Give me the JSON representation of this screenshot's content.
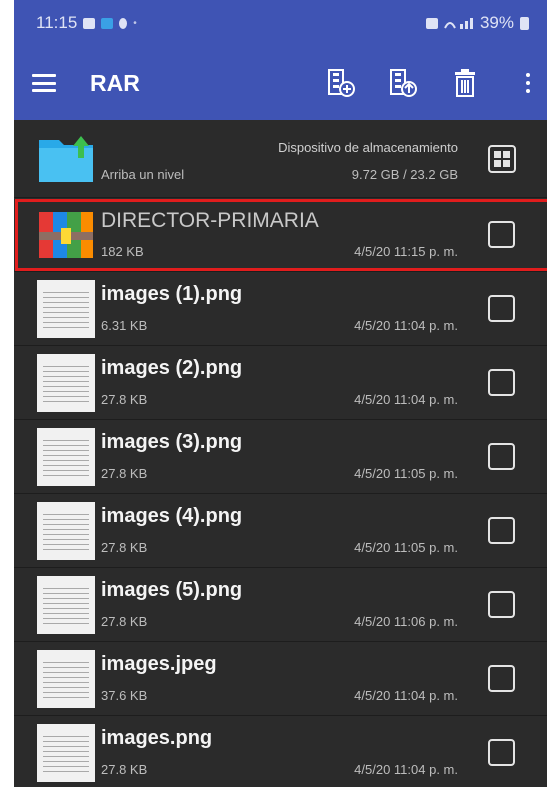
{
  "status_bar": {
    "time": "11:15",
    "battery": "39%"
  },
  "app_bar": {
    "title": "RAR",
    "menu_icon": "hamburger-menu-icon",
    "actions": [
      "add-to-archive-icon",
      "extract-from-archive-icon",
      "delete-icon",
      "more-options-icon"
    ]
  },
  "up_row": {
    "label": "Arriba un nivel",
    "device_label": "Dispositivo de almacenamiento",
    "space": "9.72 GB / 23.2 GB"
  },
  "files": [
    {
      "name": "DIRECTOR-PRIMARIA",
      "size": "182 KB",
      "date": "4/5/20 11:15 p. m.",
      "type": "archive",
      "selected": true
    },
    {
      "name": "images (1).png",
      "size": "6.31 KB",
      "date": "4/5/20 11:04 p. m.",
      "type": "image"
    },
    {
      "name": "images (2).png",
      "size": "27.8 KB",
      "date": "4/5/20 11:04 p. m.",
      "type": "image"
    },
    {
      "name": "images (3).png",
      "size": "27.8 KB",
      "date": "4/5/20 11:05 p. m.",
      "type": "image"
    },
    {
      "name": "images (4).png",
      "size": "27.8 KB",
      "date": "4/5/20 11:05 p. m.",
      "type": "image"
    },
    {
      "name": "images (5).png",
      "size": "27.8 KB",
      "date": "4/5/20 11:06 p. m.",
      "type": "image"
    },
    {
      "name": "images.jpeg",
      "size": "37.6 KB",
      "date": "4/5/20 11:04 p. m.",
      "type": "image"
    },
    {
      "name": "images.png",
      "size": "27.8 KB",
      "date": "4/5/20 11:04 p. m.",
      "type": "image"
    }
  ],
  "colors": {
    "app_bar": "#3f54b4",
    "list_bg": "#2b2b2b",
    "highlight": "#e11d1d"
  }
}
